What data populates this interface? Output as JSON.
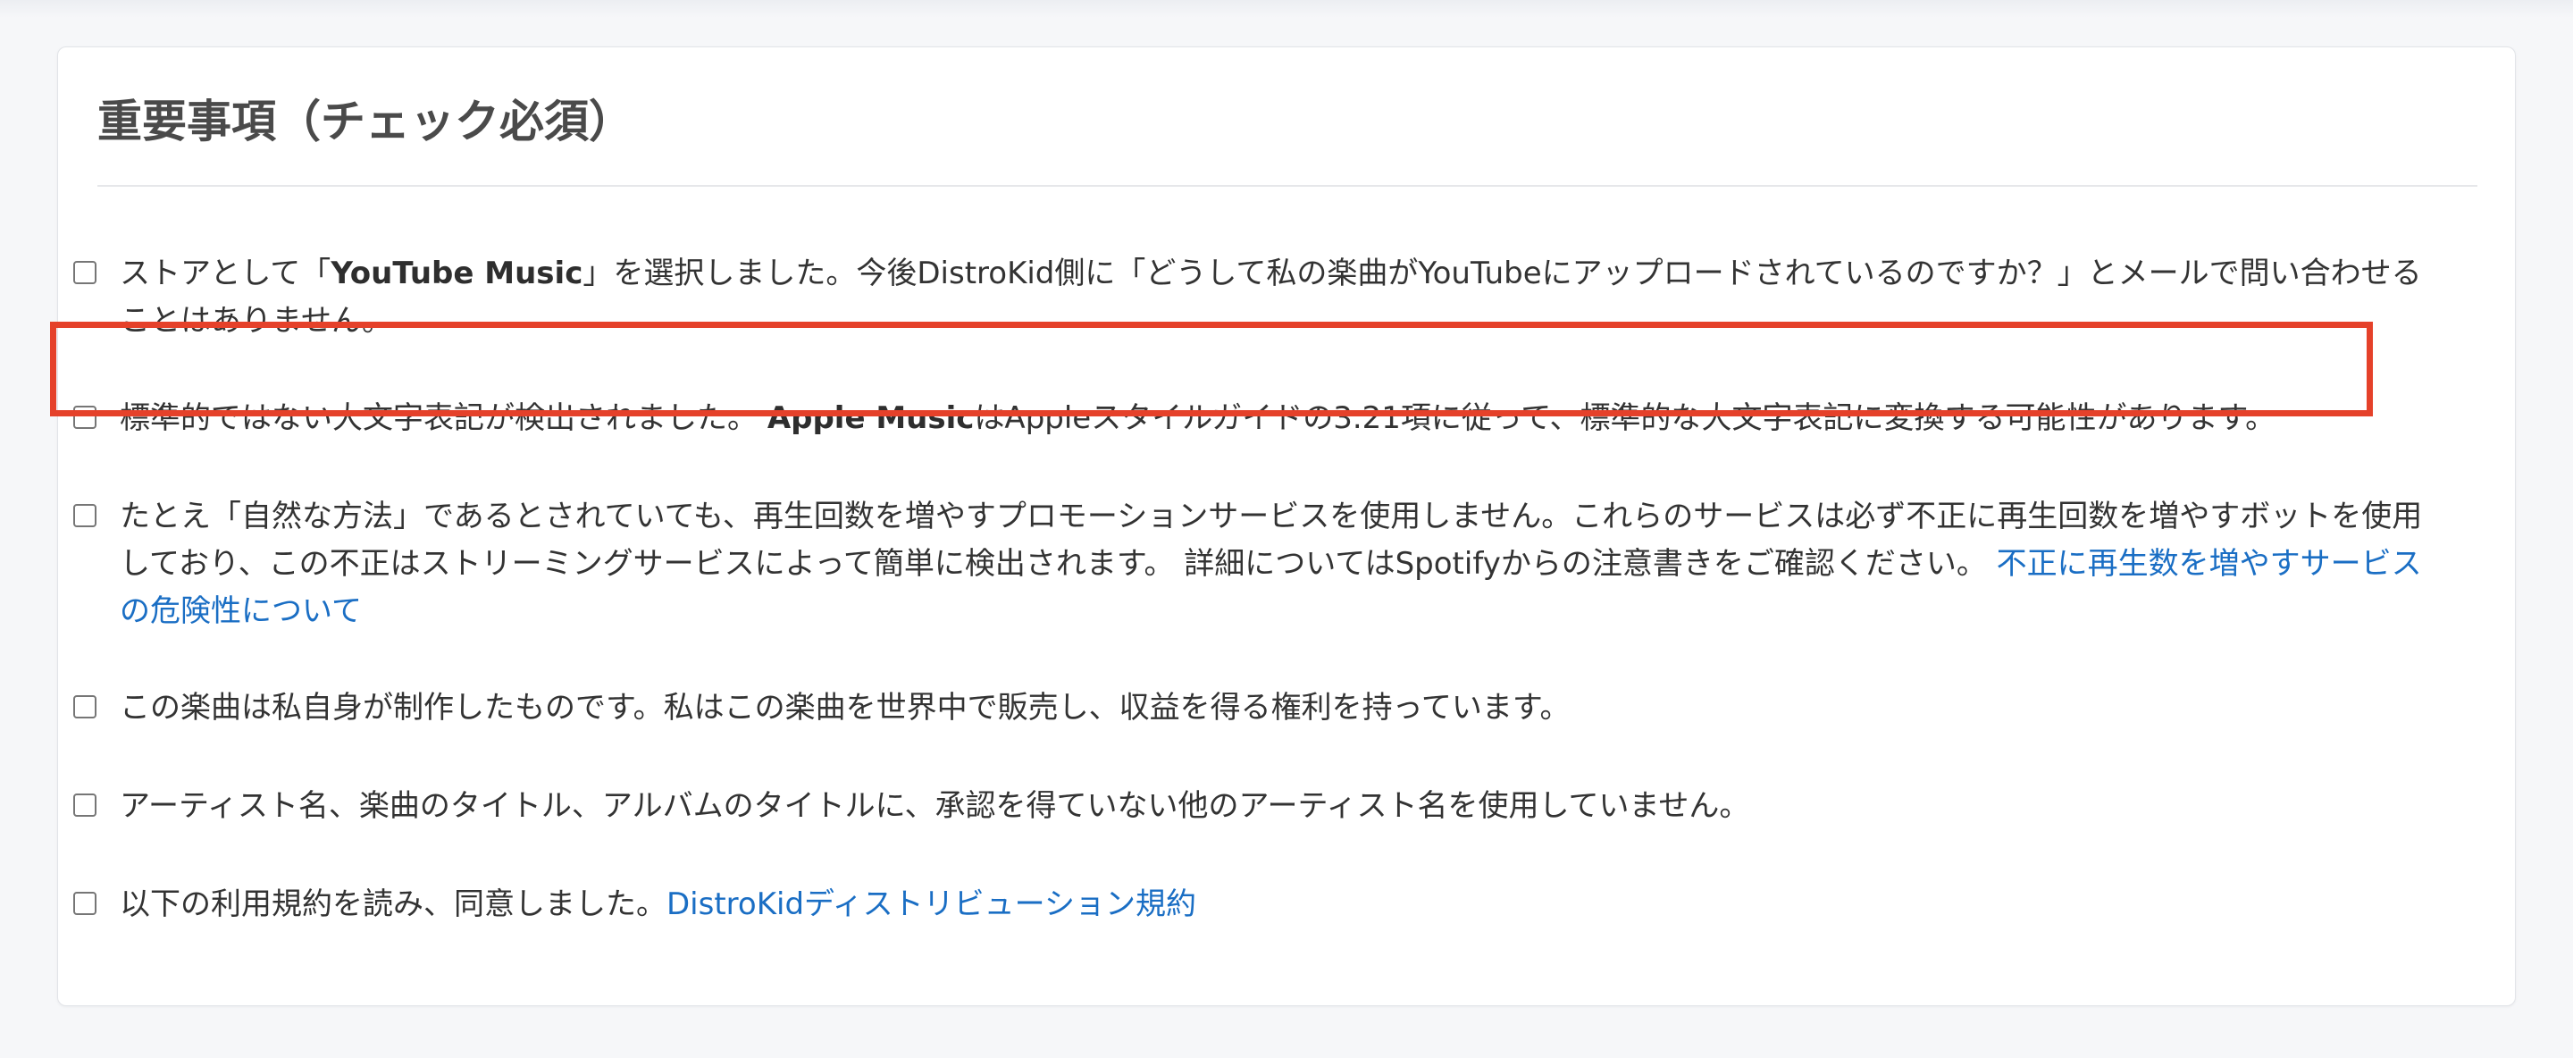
{
  "section": {
    "title": "重要事項（チェック必須）"
  },
  "items": [
    {
      "pre": "ストアとして「",
      "bold": "YouTube Music",
      "post": "」を選択しました。今後DistroKid側に「どうして私の楽曲がYouTubeにアップロードされているのですか？」とメールで問い合わせることはありません。"
    },
    {
      "pre": "標準的ではない大文字表記が検出されました。 ",
      "bold": "Apple Music",
      "post": "はAppleスタイルガイドの3.21項に従って、標準的な大文字表記に変換する可能性があります。"
    },
    {
      "text": "たとえ「自然な方法」であるとされていても、再生回数を増やすプロモーションサービスを使用しません。これらのサービスは必ず不正に再生回数を増やすボットを使用しており、この不正はストリーミングサービスによって簡単に検出されます。 詳細についてはSpotifyからの注意書きをご確認ください。 ",
      "link": "不正に再生数を増やすサービスの危険性について"
    },
    {
      "text": "この楽曲は私自身が制作したものです。私はこの楽曲を世界中で販売し、収益を得る権利を持っています。"
    },
    {
      "text": "アーティスト名、楽曲のタイトル、アルバムのタイトルに、承認を得ていない他のアーティスト名を使用していません。"
    },
    {
      "text": "以下の利用規約を読み、同意しました。",
      "link": "DistroKidディストリビューション規約"
    }
  ],
  "colors": {
    "highlight_border": "#e5412a",
    "link": "#1a6ec4"
  }
}
